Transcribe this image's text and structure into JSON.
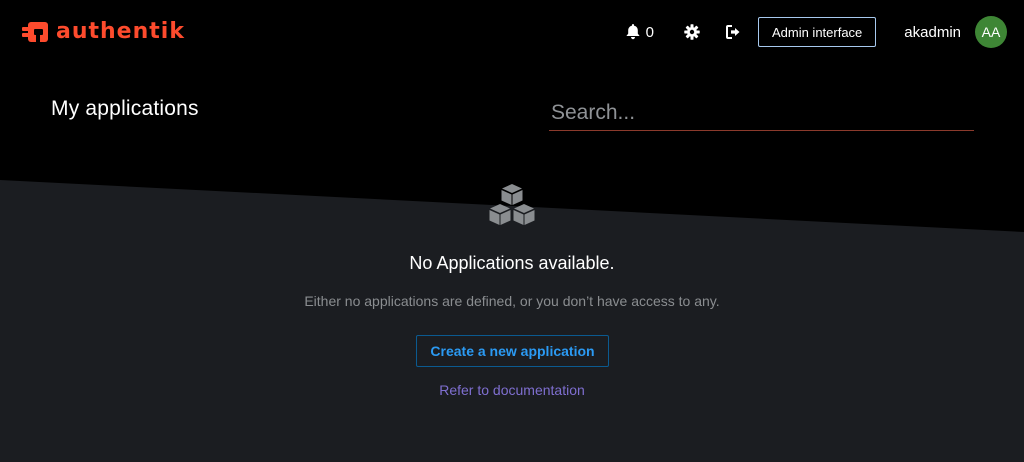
{
  "brand": {
    "name": "authentik",
    "logo_icon": "authentik-logo-icon",
    "color": "#fd4b2d"
  },
  "header": {
    "notifications": {
      "icon": "bell-icon",
      "count": "0"
    },
    "settings_icon": "gear-icon",
    "logout_icon": "sign-out-icon",
    "admin_button_label": "Admin interface",
    "username": "akadmin",
    "avatar_initials": "AA",
    "avatar_color": "#3e8635"
  },
  "main": {
    "title": "My applications",
    "search": {
      "placeholder": "Search...",
      "value": ""
    }
  },
  "empty_state": {
    "icon": "cubes-icon",
    "title": "No Applications available.",
    "description": "Either no applications are defined, or you don’t have access to any.",
    "create_button_label": "Create a new application",
    "docs_link_label": "Refer to documentation"
  },
  "colors": {
    "header_bg": "#000000",
    "body_bg": "#1b1d21",
    "link_blue": "#2b9af3",
    "link_purple": "#7f6fd0"
  }
}
